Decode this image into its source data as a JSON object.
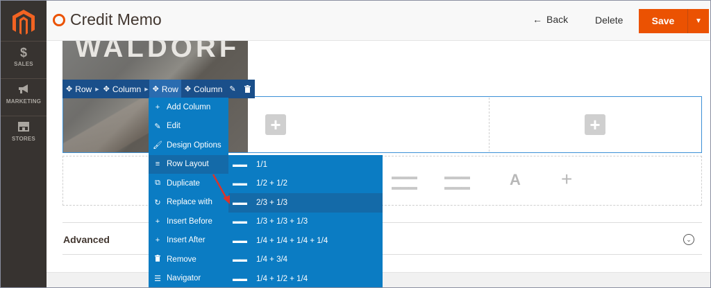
{
  "sidebar": {
    "logo": "magento-logo-icon",
    "items": [
      {
        "icon": "$",
        "label": "SALES"
      },
      {
        "icon": "megaphone",
        "label": "MARKETING"
      },
      {
        "icon": "store",
        "label": "STORES"
      }
    ]
  },
  "header": {
    "title": "Credit Memo",
    "back_label": "Back",
    "delete_label": "Delete",
    "save_label": "Save"
  },
  "content": {
    "image_text": "WALDORF",
    "advanced_label": "Advanced"
  },
  "breadcrumb": {
    "items": [
      "Row",
      "Column",
      "Row",
      "Column"
    ],
    "active_index": 2
  },
  "context_menu": {
    "items": [
      {
        "icon": "plus",
        "label": "Add Column"
      },
      {
        "icon": "pencil",
        "label": "Edit"
      },
      {
        "icon": "brush",
        "label": "Design Options"
      },
      {
        "icon": "rows",
        "label": "Row Layout"
      },
      {
        "icon": "duplicate",
        "label": "Duplicate"
      },
      {
        "icon": "replace",
        "label": "Replace with"
      },
      {
        "icon": "plus",
        "label": "Insert Before"
      },
      {
        "icon": "plus",
        "label": "Insert After"
      },
      {
        "icon": "trash",
        "label": "Remove"
      },
      {
        "icon": "layers",
        "label": "Navigator"
      }
    ],
    "highlighted_index": 3
  },
  "row_layout_submenu": {
    "items": [
      "1/1",
      "1/2 + 1/2",
      "2/3 + 1/3",
      "1/3 + 1/3 + 1/3",
      "1/4 + 1/4 + 1/4 + 1/4",
      "1/4 + 3/4",
      "1/4 + 1/2 + 1/4"
    ],
    "highlighted_index": 2
  },
  "colors": {
    "accent": "#eb5202",
    "sidebar": "#373330",
    "menu_blue": "#0b7cc3",
    "menu_highlight": "#146aa8",
    "toolbar_blue": "#1a4f8a",
    "arrow_red": "#d9342b"
  }
}
